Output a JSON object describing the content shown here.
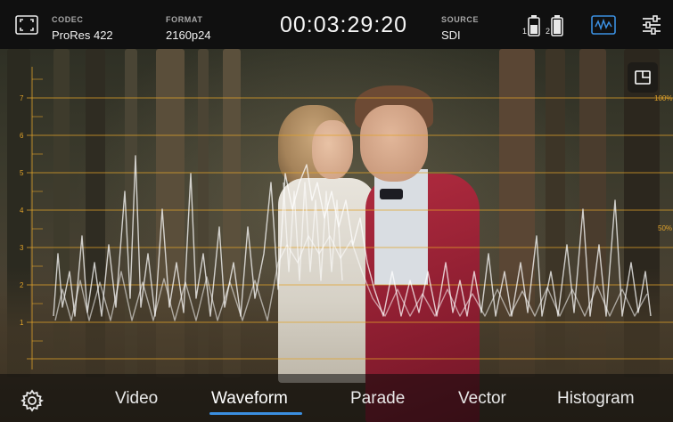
{
  "topbar": {
    "codec": {
      "caption": "CODEC",
      "value": "ProRes 422"
    },
    "format": {
      "caption": "FORMAT",
      "value": "2160p24"
    },
    "timecode": "00:03:29:20",
    "source": {
      "caption": "SOURCE",
      "value": "SDI"
    },
    "battery_labels": [
      "1",
      "2"
    ],
    "icons": {
      "fullscreen": "fullscreen-icon",
      "battery": "battery-icon",
      "waveform_toggle": "waveform-icon",
      "settings": "sliders-icon"
    },
    "accent_color": "#3b8fe0"
  },
  "overlay": {
    "scale_labels": [
      "7",
      "6",
      "5",
      "4",
      "3",
      "2",
      "1"
    ],
    "percent_labels": [
      "100%",
      "50%"
    ],
    "graticule_color": "#e1a32a",
    "corner_icon": "picture-in-picture-icon"
  },
  "nav": {
    "settings_icon": "gear-icon",
    "items": [
      "Video",
      "Waveform",
      "Parade",
      "Vector",
      "Histogram"
    ],
    "active": "Waveform"
  }
}
